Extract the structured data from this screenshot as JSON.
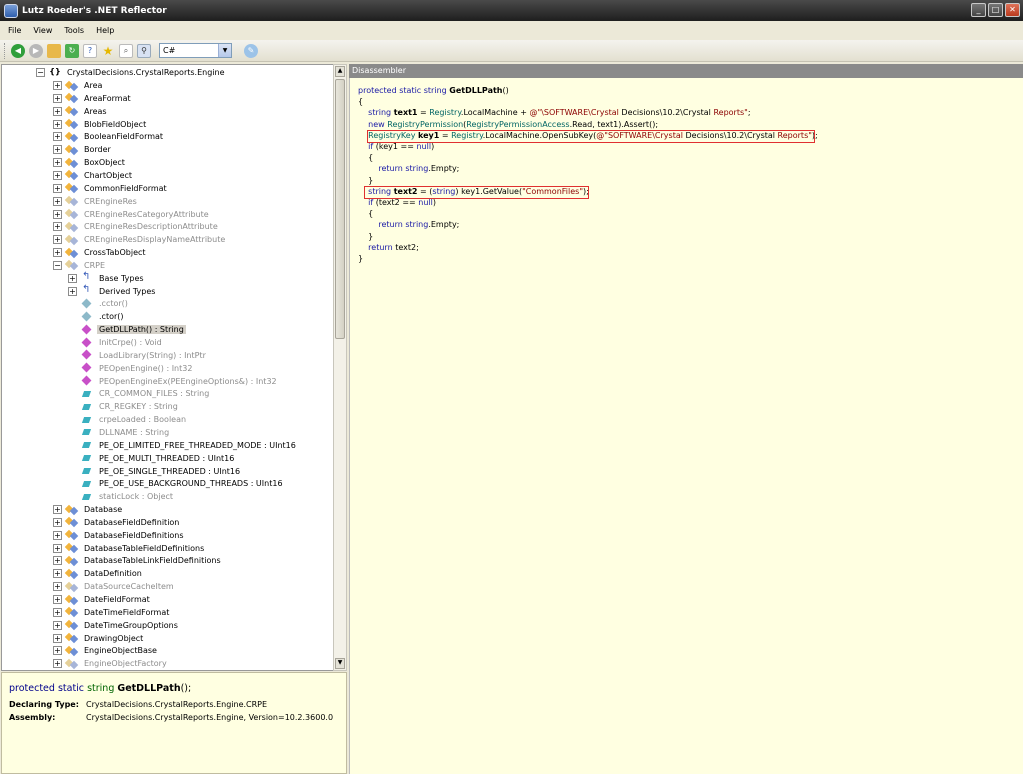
{
  "window": {
    "title": "Lutz Roeder's .NET Reflector",
    "controls": [
      "_",
      "□",
      "✕"
    ]
  },
  "menu": [
    "File",
    "View",
    "Tools",
    "Help"
  ],
  "toolbar": {
    "language": "C#"
  },
  "tree": {
    "root": "CrystalDecisions.CrystalReports.Engine",
    "items": [
      {
        "label": "Area",
        "style": "normal"
      },
      {
        "label": "AreaFormat",
        "style": "normal"
      },
      {
        "label": "Areas",
        "style": "normal"
      },
      {
        "label": "BlobFieldObject",
        "style": "normal"
      },
      {
        "label": "BooleanFieldFormat",
        "style": "normal"
      },
      {
        "label": "Border",
        "style": "normal"
      },
      {
        "label": "BoxObject",
        "style": "normal"
      },
      {
        "label": "ChartObject",
        "style": "normal"
      },
      {
        "label": "CommonFieldFormat",
        "style": "normal"
      },
      {
        "label": "CREngineRes",
        "style": "gray"
      },
      {
        "label": "CREngineResCategoryAttribute",
        "style": "gray"
      },
      {
        "label": "CREngineResDescriptionAttribute",
        "style": "gray"
      },
      {
        "label": "CREngineResDisplayNameAttribute",
        "style": "gray"
      },
      {
        "label": "CrossTabObject",
        "style": "normal"
      },
      {
        "label": "CRPE",
        "style": "gray",
        "expanded": true
      }
    ],
    "crpe_children": [
      {
        "label": "Base Types",
        "kind": "base",
        "expandable": true
      },
      {
        "label": "Derived Types",
        "kind": "derived",
        "expandable": true
      },
      {
        "label": ".cctor()",
        "kind": "meth-cyan",
        "gray": true
      },
      {
        "label": ".ctor()",
        "kind": "meth-cyan",
        "gray": false
      },
      {
        "label": "GetDLLPath() : String",
        "kind": "meth",
        "gray": false,
        "selected": true
      },
      {
        "label": "InitCrpe() : Void",
        "kind": "meth",
        "gray": true
      },
      {
        "label": "LoadLibrary(String) : IntPtr",
        "kind": "meth",
        "gray": true
      },
      {
        "label": "PEOpenEngine() : Int32",
        "kind": "meth",
        "gray": true
      },
      {
        "label": "PEOpenEngineEx(PEEngineOptions&) : Int32",
        "kind": "meth",
        "gray": true
      },
      {
        "label": "CR_COMMON_FILES : String",
        "kind": "field",
        "gray": true
      },
      {
        "label": "CR_REGKEY : String",
        "kind": "field",
        "gray": true
      },
      {
        "label": "crpeLoaded : Boolean",
        "kind": "field",
        "gray": true
      },
      {
        "label": "DLLNAME : String",
        "kind": "field",
        "gray": true
      },
      {
        "label": "PE_OE_LIMITED_FREE_THREADED_MODE : UInt16",
        "kind": "field",
        "gray": false
      },
      {
        "label": "PE_OE_MULTI_THREADED : UInt16",
        "kind": "field",
        "gray": false
      },
      {
        "label": "PE_OE_SINGLE_THREADED : UInt16",
        "kind": "field",
        "gray": false
      },
      {
        "label": "PE_OE_USE_BACKGROUND_THREADS : UInt16",
        "kind": "field",
        "gray": false
      },
      {
        "label": "staticLock : Object",
        "kind": "field",
        "gray": true
      }
    ],
    "after": [
      {
        "label": "Database",
        "style": "normal"
      },
      {
        "label": "DatabaseFieldDefinition",
        "style": "normal"
      },
      {
        "label": "DatabaseFieldDefinitions",
        "style": "normal"
      },
      {
        "label": "DatabaseTableFieldDefinitions",
        "style": "normal"
      },
      {
        "label": "DatabaseTableLinkFieldDefinitions",
        "style": "normal"
      },
      {
        "label": "DataDefinition",
        "style": "normal"
      },
      {
        "label": "DataSourceCacheItem",
        "style": "gray"
      },
      {
        "label": "DateFieldFormat",
        "style": "normal"
      },
      {
        "label": "DateTimeFieldFormat",
        "style": "normal"
      },
      {
        "label": "DateTimeGroupOptions",
        "style": "normal"
      },
      {
        "label": "DrawingObject",
        "style": "normal"
      },
      {
        "label": "EngineObjectBase",
        "style": "normal"
      },
      {
        "label": "EngineObjectFactory",
        "style": "gray"
      }
    ]
  },
  "info": {
    "sig_kw": "protected static",
    "sig_type": "string",
    "sig_name": "GetDLLPath",
    "sig_tail": "();",
    "declaring_label": "Declaring Type:",
    "declaring_value": "CrystalDecisions.CrystalReports.Engine.CRPE",
    "assembly_label": "Assembly:",
    "assembly_value": "CrystalDecisions.CrystalReports.Engine, Version=10.2.3600.0"
  },
  "disassembler": {
    "header": "Disassembler",
    "lines": [
      "protected static string GetDLLPath()",
      "{",
      "    string text1 = Registry.LocalMachine + @\"\\SOFTWARE\\Crystal Decisions\\10.2\\Crystal Reports\";",
      "    new RegistryPermission(RegistryPermissionAccess.Read, text1).Assert();",
      "    RegistryKey key1 = Registry.LocalMachine.OpenSubKey(@\"SOFTWARE\\Crystal Decisions\\10.2\\Crystal Reports\");",
      "    if (key1 == null)",
      "    {",
      "        return string.Empty;",
      "    }",
      "    string text2 = (string) key1.GetValue(\"CommonFiles\");",
      "    if (text2 == null)",
      "    {",
      "        return string.Empty;",
      "    }",
      "    return text2;",
      "}"
    ]
  }
}
